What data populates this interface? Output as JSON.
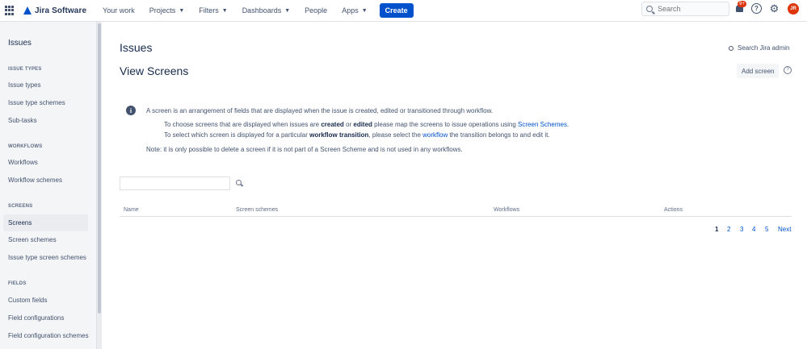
{
  "topnav": {
    "logo_text": "Jira Software",
    "items": [
      {
        "label": "Your work"
      },
      {
        "label": "Projects"
      },
      {
        "label": "Filters"
      },
      {
        "label": "Dashboards"
      },
      {
        "label": "People"
      },
      {
        "label": "Apps"
      }
    ],
    "create_label": "Create",
    "search_placeholder": "Search",
    "notification_count": "9+",
    "help_glyph": "?",
    "avatar_initials": "JR"
  },
  "sidebar": {
    "title": "Issues",
    "groups": [
      {
        "heading": "Issue types",
        "items": [
          "Issue types",
          "Issue type schemes",
          "Sub-tasks"
        ]
      },
      {
        "heading": "Workflows",
        "items": [
          "Workflows",
          "Workflow schemes"
        ]
      },
      {
        "heading": "Screens",
        "items": [
          "Screens",
          "Screen schemes",
          "Issue type screen schemes"
        ]
      },
      {
        "heading": "Fields",
        "items": [
          "Custom fields",
          "Field configurations",
          "Field configuration schemes"
        ]
      }
    ],
    "active_item": "Screens"
  },
  "main": {
    "page_title": "Issues",
    "search_admin_label": "Search Jira admin",
    "view_title": "View Screens",
    "add_screen_label": "Add screen",
    "info": {
      "line1": "A screen is an arrangement of fields that are displayed when the issue is created, edited or transitioned through workflow.",
      "line2_a": "To choose screens that are displayed when issues are ",
      "line2_b": "created",
      "line2_c": " or ",
      "line2_d": "edited",
      "line2_e": " please map the screens to issue operations using ",
      "line2_link": "Screen Schemes",
      "line2_f": ".",
      "line3_a": "To select which screen is displayed for a particular ",
      "line3_b": "workflow transition",
      "line3_c": ", please select the ",
      "line3_link": "workflow",
      "line3_d": " the transition belongs to and edit it.",
      "note": "Note: it is only possible to delete a screen if it is not part of a Screen Scheme and is not used in any workflows."
    },
    "table_headers": [
      "Name",
      "Screen schemes",
      "Workflows",
      "Actions"
    ],
    "pagination": {
      "pages": [
        "1",
        "2",
        "3",
        "4",
        "5"
      ],
      "current": "1",
      "next_label": "Next"
    }
  }
}
